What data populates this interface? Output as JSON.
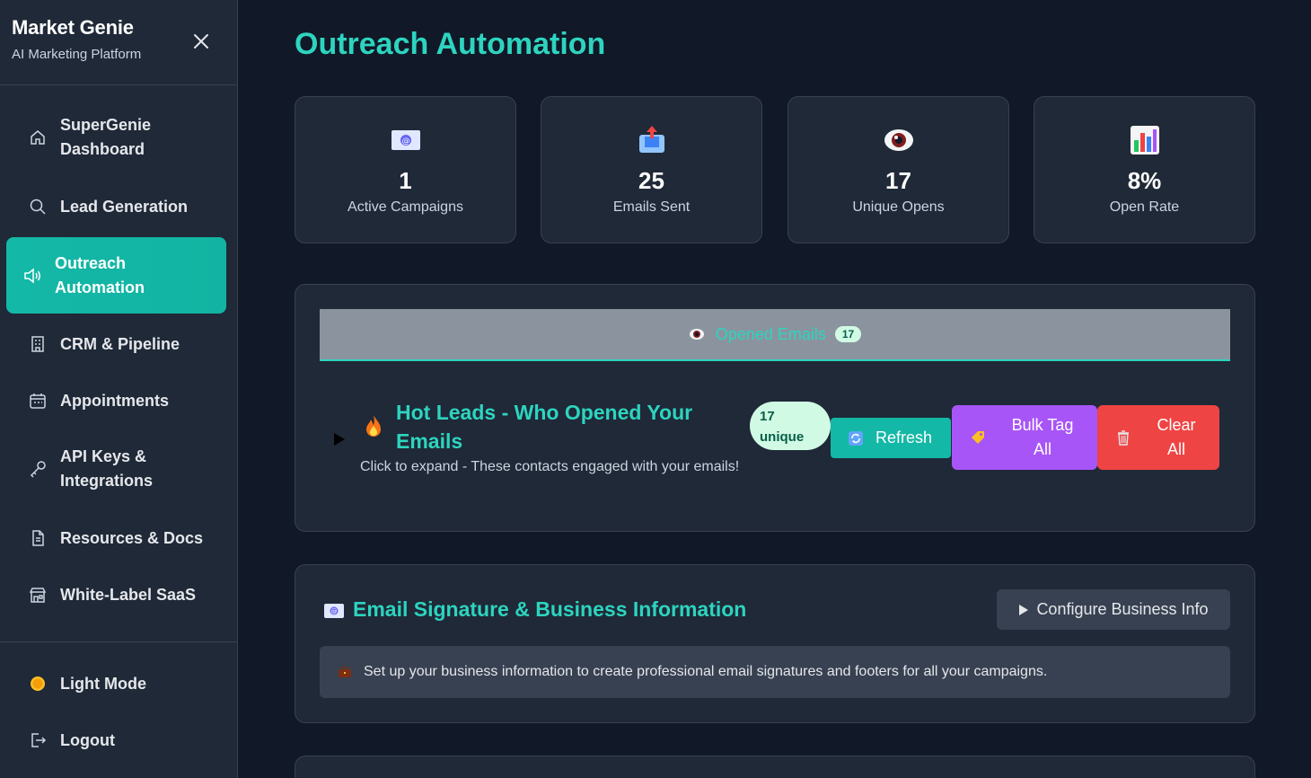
{
  "brand": {
    "title": "Market Genie",
    "subtitle": "AI Marketing Platform"
  },
  "sidebar": {
    "items": [
      {
        "label": "SuperGenie Dashboard",
        "icon": "home-icon"
      },
      {
        "label": "Lead Generation",
        "icon": "search-icon"
      },
      {
        "label": "Outreach Automation",
        "icon": "speaker-icon",
        "active": true
      },
      {
        "label": "CRM & Pipeline",
        "icon": "building-icon"
      },
      {
        "label": "Appointments",
        "icon": "calendar-icon"
      },
      {
        "label": "API Keys & Integrations",
        "icon": "key-icon"
      },
      {
        "label": "Resources & Docs",
        "icon": "document-icon"
      },
      {
        "label": "White-Label SaaS",
        "icon": "store-icon"
      }
    ],
    "footer": {
      "light_mode": "Light Mode",
      "logout": "Logout"
    }
  },
  "page": {
    "title": "Outreach Automation"
  },
  "stats": [
    {
      "value": "1",
      "label": "Active Campaigns",
      "icon": "email-icon"
    },
    {
      "value": "25",
      "label": "Emails Sent",
      "icon": "outbox-icon"
    },
    {
      "value": "17",
      "label": "Unique Opens",
      "icon": "eye-icon"
    },
    {
      "value": "8%",
      "label": "Open Rate",
      "icon": "bar-chart-icon"
    }
  ],
  "opened": {
    "tab_label": "Opened Emails",
    "tab_count": "17",
    "hot_title": "Hot Leads - Who Opened Your Emails",
    "hot_sub": "Click to expand - These contacts engaged with your emails!",
    "unique_count": "17",
    "unique_label": "unique",
    "refresh": "Refresh",
    "bulk_line1": "Bulk Tag",
    "bulk_line2": "All",
    "clear_line1": "Clear",
    "clear_line2": "All"
  },
  "signature": {
    "title": "Email Signature & Business Information",
    "configure": "Configure Business Info",
    "info": "Set up your business information to create professional email signatures and footers for all your campaigns."
  },
  "colors": {
    "accent": "#2dd4bf",
    "active_nav": "#14b8a6",
    "bulk": "#a855f7",
    "clear": "#ef4444"
  }
}
